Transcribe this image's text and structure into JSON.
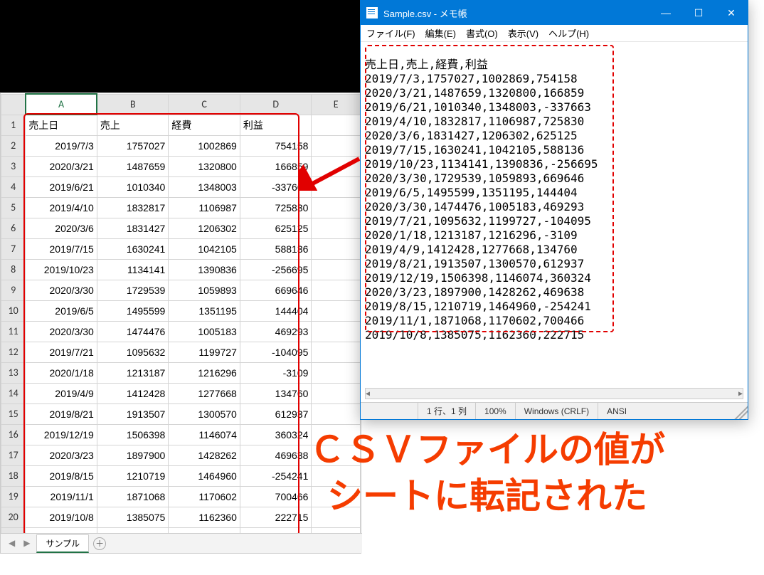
{
  "spreadsheet": {
    "columns": [
      "A",
      "B",
      "C",
      "D",
      "E"
    ],
    "headers": [
      "売上日",
      "売上",
      "経費",
      "利益"
    ],
    "rows": [
      {
        "date": "2019/7/3",
        "sales": 1757027,
        "cost": 1002869,
        "profit": 754158
      },
      {
        "date": "2020/3/21",
        "sales": 1487659,
        "cost": 1320800,
        "profit": 166859
      },
      {
        "date": "2019/6/21",
        "sales": 1010340,
        "cost": 1348003,
        "profit": -337663
      },
      {
        "date": "2019/4/10",
        "sales": 1832817,
        "cost": 1106987,
        "profit": 725830
      },
      {
        "date": "2020/3/6",
        "sales": 1831427,
        "cost": 1206302,
        "profit": 625125
      },
      {
        "date": "2019/7/15",
        "sales": 1630241,
        "cost": 1042105,
        "profit": 588136
      },
      {
        "date": "2019/10/23",
        "sales": 1134141,
        "cost": 1390836,
        "profit": -256695
      },
      {
        "date": "2020/3/30",
        "sales": 1729539,
        "cost": 1059893,
        "profit": 669646
      },
      {
        "date": "2019/6/5",
        "sales": 1495599,
        "cost": 1351195,
        "profit": 144404
      },
      {
        "date": "2020/3/30",
        "sales": 1474476,
        "cost": 1005183,
        "profit": 469293
      },
      {
        "date": "2019/7/21",
        "sales": 1095632,
        "cost": 1199727,
        "profit": -104095
      },
      {
        "date": "2020/1/18",
        "sales": 1213187,
        "cost": 1216296,
        "profit": -3109
      },
      {
        "date": "2019/4/9",
        "sales": 1412428,
        "cost": 1277668,
        "profit": 134760
      },
      {
        "date": "2019/8/21",
        "sales": 1913507,
        "cost": 1300570,
        "profit": 612937
      },
      {
        "date": "2019/12/19",
        "sales": 1506398,
        "cost": 1146074,
        "profit": 360324
      },
      {
        "date": "2020/3/23",
        "sales": 1897900,
        "cost": 1428262,
        "profit": 469638
      },
      {
        "date": "2019/8/15",
        "sales": 1210719,
        "cost": 1464960,
        "profit": -254241
      },
      {
        "date": "2019/11/1",
        "sales": 1871068,
        "cost": 1170602,
        "profit": 700466
      },
      {
        "date": "2019/10/8",
        "sales": 1385075,
        "cost": 1162360,
        "profit": 222715
      }
    ],
    "tab": "サンプル"
  },
  "notepad": {
    "title": "Sample.csv - メモ帳",
    "menu": [
      "ファイル(F)",
      "編集(E)",
      "書式(O)",
      "表示(V)",
      "ヘルプ(H)"
    ],
    "lines": [
      "売上日,売上,経費,利益",
      "2019/7/3,1757027,1002869,754158",
      "2020/3/21,1487659,1320800,166859",
      "2019/6/21,1010340,1348003,-337663",
      "2019/4/10,1832817,1106987,725830",
      "2020/3/6,1831427,1206302,625125",
      "2019/7/15,1630241,1042105,588136",
      "2019/10/23,1134141,1390836,-256695",
      "2020/3/30,1729539,1059893,669646",
      "2019/6/5,1495599,1351195,144404",
      "2020/3/30,1474476,1005183,469293",
      "2019/7/21,1095632,1199727,-104095",
      "2020/1/18,1213187,1216296,-3109",
      "2019/4/9,1412428,1277668,134760",
      "2019/8/21,1913507,1300570,612937",
      "2019/12/19,1506398,1146074,360324",
      "2020/3/23,1897900,1428262,469638",
      "2019/8/15,1210719,1464960,-254241",
      "2019/11/1,1871068,1170602,700466",
      "2019/10/8,1385075,1162360,222715"
    ],
    "status": {
      "pos": "1 行、1 列",
      "zoom": "100%",
      "encoding_end": "Windows (CRLF)",
      "encoding": "ANSI"
    }
  },
  "caption": {
    "line1": "ＣＳＶファイルの値が",
    "line2": "シートに転記された"
  }
}
